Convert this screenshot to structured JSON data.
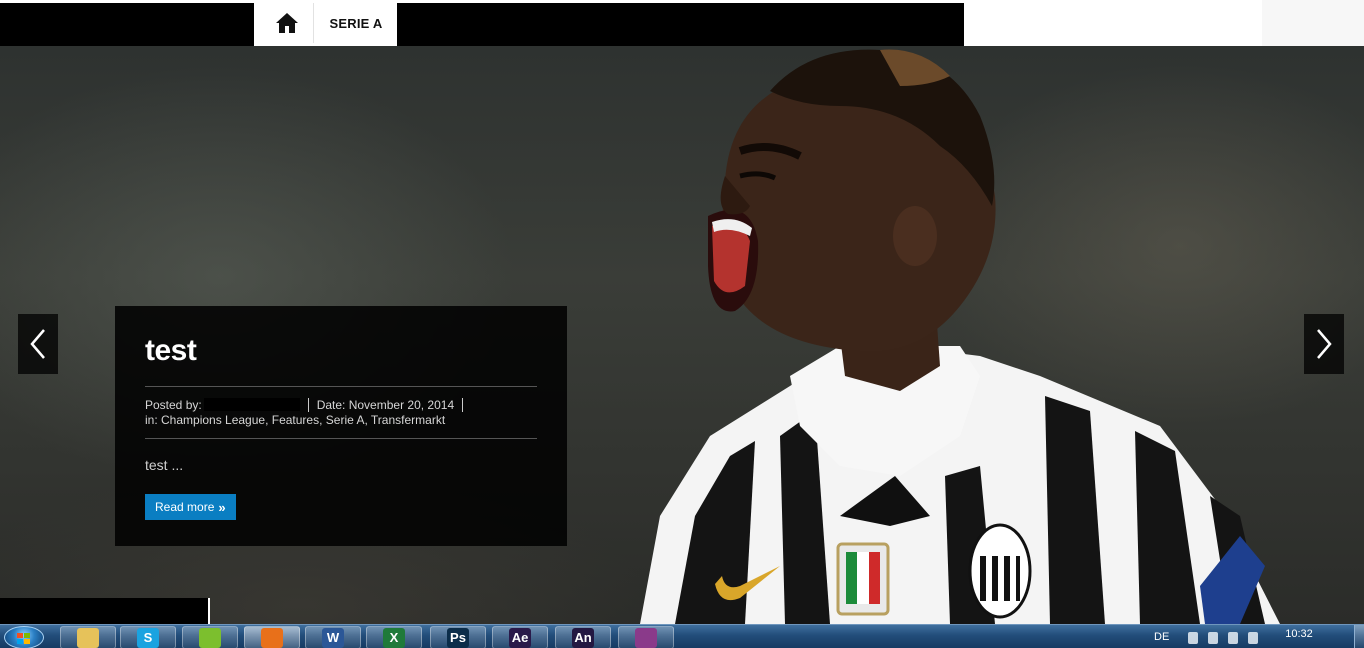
{
  "nav": {
    "home_icon": "home-icon",
    "items": [
      {
        "label": "SERIE A"
      }
    ]
  },
  "slider": {
    "prev_icon": "chevron-left-icon",
    "next_icon": "chevron-right-icon",
    "slide": {
      "title": "test",
      "posted_by_label": "Posted by:",
      "date_text": "Date: November 20, 2014",
      "categories_text": "in: Champions League, Features, Serie A, Transfermarkt",
      "excerpt": "test ...",
      "read_more_label": "Read more"
    }
  },
  "taskbar": {
    "start_icon": "windows-start-icon",
    "apps": [
      {
        "name": "explorer",
        "icon": "folder-icon",
        "label": "",
        "color": "#e6c25a"
      },
      {
        "name": "skype",
        "icon": "skype-icon",
        "label": "S",
        "color": "#1aa3e0"
      },
      {
        "name": "spotify",
        "icon": "spotify-icon",
        "label": "",
        "color": "#7cbf2e"
      },
      {
        "name": "firefox",
        "icon": "firefox-icon",
        "label": "",
        "color": "#e8701a"
      },
      {
        "name": "word",
        "icon": "word-icon",
        "label": "W",
        "color": "#2b5797"
      },
      {
        "name": "excel",
        "icon": "excel-icon",
        "label": "X",
        "color": "#1f7a3a"
      },
      {
        "name": "photoshop",
        "icon": "photoshop-icon",
        "label": "Ps",
        "color": "#0b2d4a"
      },
      {
        "name": "after-effects",
        "icon": "after-effects-icon",
        "label": "Ae",
        "color": "#2a1a4a"
      },
      {
        "name": "animate",
        "icon": "animate-icon",
        "label": "An",
        "color": "#231842"
      },
      {
        "name": "winrar",
        "icon": "winrar-icon",
        "label": "",
        "color": "#8a3a8a"
      }
    ],
    "tray": {
      "language": "DE",
      "time": "10:32"
    }
  },
  "colors": {
    "accent_button": "#0a7ec2",
    "caption_bg": "#000000"
  }
}
